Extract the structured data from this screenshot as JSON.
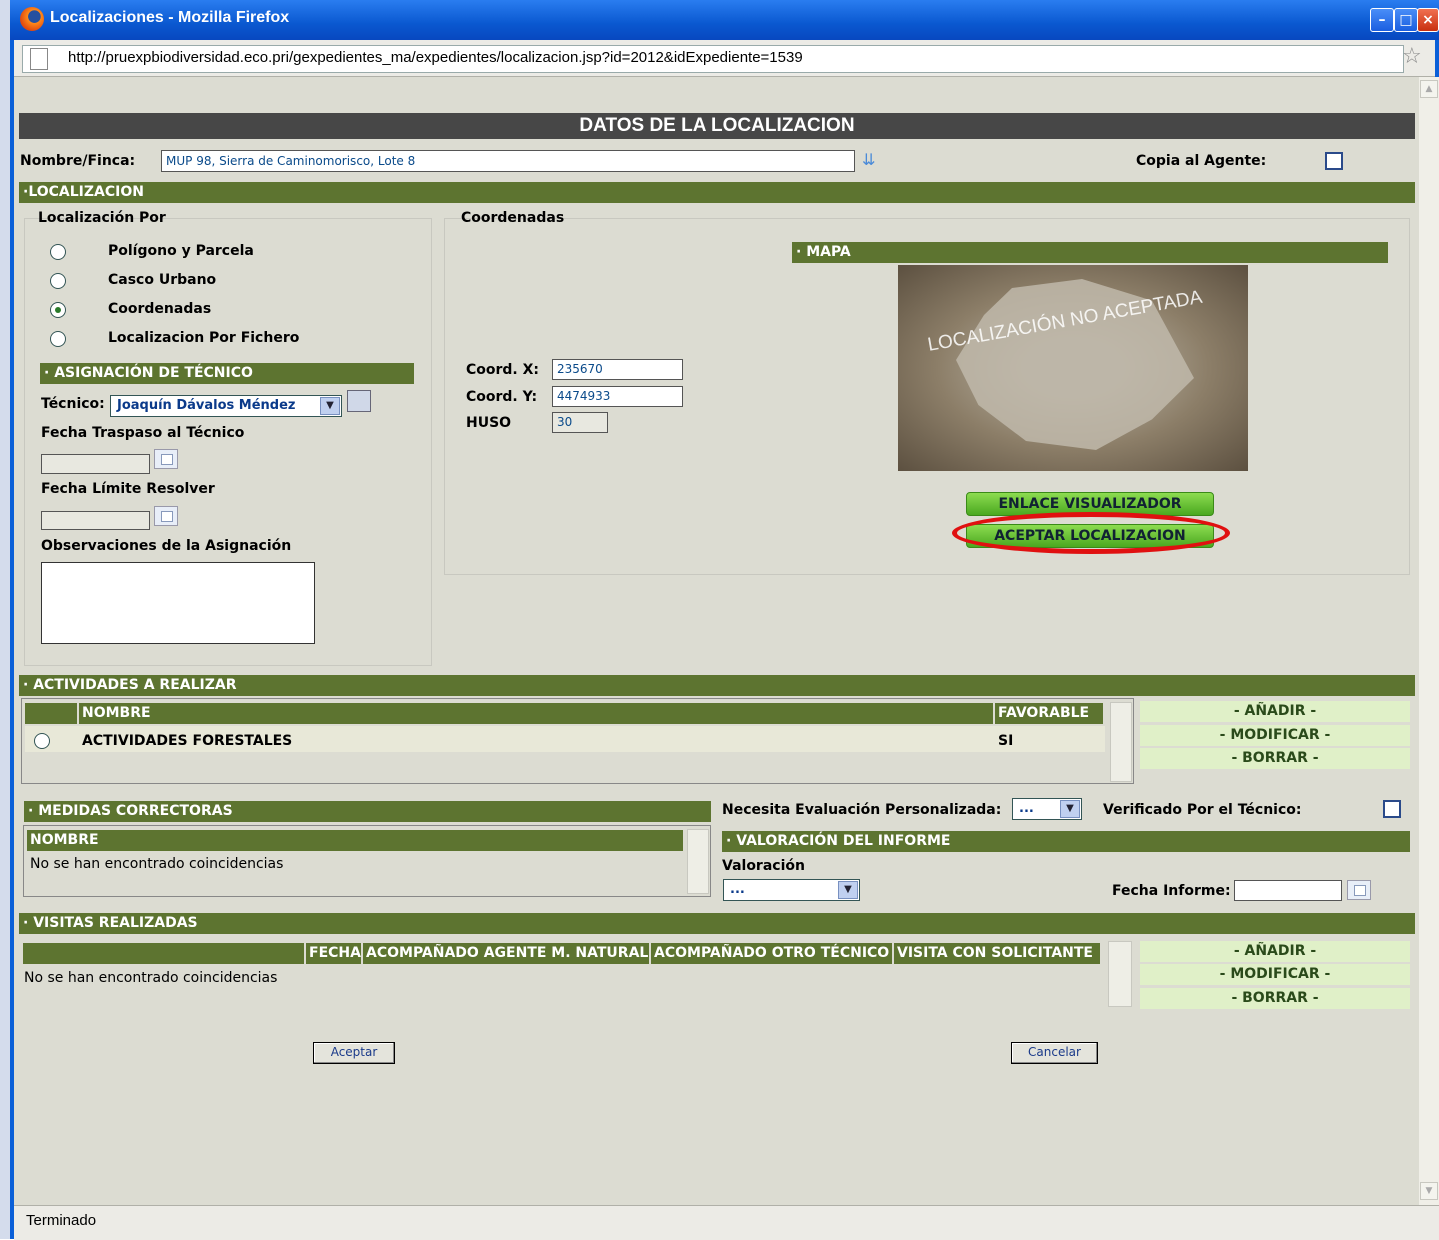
{
  "window": {
    "title": "Localizaciones - Mozilla Firefox",
    "url": "http://pruexpbiodiversidad.eco.pri/gexpedientes_ma/expedientes/localizacion.jsp?id=2012&idExpediente=1539",
    "status": "Terminado"
  },
  "header": {
    "title": "DATOS DE LA LOCALIZACION"
  },
  "finca": {
    "label": "Nombre/Finca:",
    "value": "MUP 98, Sierra de Caminomorisco, Lote 8",
    "copia_label": "Copia al Agente:",
    "copia_checked": false
  },
  "localizacion": {
    "section_title": "·LOCALIZACION",
    "por_title": "Localización Por",
    "options": [
      {
        "label": "Polígono y Parcela",
        "selected": false
      },
      {
        "label": "Casco Urbano",
        "selected": false
      },
      {
        "label": "Coordenadas",
        "selected": true
      },
      {
        "label": "Localizacion Por Fichero",
        "selected": false
      }
    ],
    "coordenadas_title": "Coordenadas",
    "coord_x_label": "Coord. X:",
    "coord_x": "235670",
    "coord_y_label": "Coord. Y:",
    "coord_y": "4474933",
    "huso_label": "HUSO",
    "huso": "30",
    "mapa_title": "· MAPA",
    "map_watermark": "LOCALIZACIÓN NO ACEPTADA",
    "btn_enlace": "ENLACE VISUALIZADOR",
    "btn_aceptar": "ACEPTAR LOCALIZACION"
  },
  "asignacion": {
    "title": "· ASIGNACIÓN DE TÉCNICO",
    "tecnico_label": "Técnico:",
    "tecnico_value": "Joaquín Dávalos Méndez",
    "fecha_traspaso_label": "Fecha Traspaso al Técnico",
    "fecha_limite_label": "Fecha Límite Resolver",
    "observaciones_label": "Observaciones de la Asignación"
  },
  "actividades": {
    "title": "· ACTIVIDADES A REALIZAR",
    "columns": [
      "NOMBRE",
      "FAVORABLE"
    ],
    "rows": [
      {
        "nombre": "ACTIVIDADES FORESTALES",
        "favorable": "SI"
      }
    ],
    "actions": [
      "- AÑADIR -",
      "- MODIFICAR -",
      "- BORRAR -"
    ]
  },
  "medidas": {
    "title": "· MEDIDAS CORRECTORAS",
    "column": "NOMBRE",
    "empty": "No se han encontrado coincidencias",
    "evaluacion_label": "Necesita Evaluación Personalizada:",
    "evaluacion_value": "...",
    "verificado_label": "Verificado Por el Técnico:",
    "verificado_checked": false
  },
  "valoracion": {
    "title": "· VALORACIÓN DEL INFORME",
    "label": "Valoración",
    "value": "...",
    "fecha_informe_label": "Fecha Informe:"
  },
  "visitas": {
    "title": "· VISITAS REALIZADAS",
    "columns": [
      "FECHA",
      "ACOMPAÑADO AGENTE M. NATURAL",
      "ACOMPAÑADO OTRO TÉCNICO",
      "VISITA CON SOLICITANTE"
    ],
    "empty": "No se han encontrado coincidencias",
    "actions": [
      "- AÑADIR -",
      "- MODIFICAR -",
      "- BORRAR -"
    ]
  },
  "footer": {
    "aceptar": "Aceptar",
    "cancelar": "Cancelar"
  },
  "colors": {
    "section_green": "#5d7430",
    "header_dark": "#474747",
    "highlight": "#e01010",
    "link_bg": "#e0f0c8"
  }
}
